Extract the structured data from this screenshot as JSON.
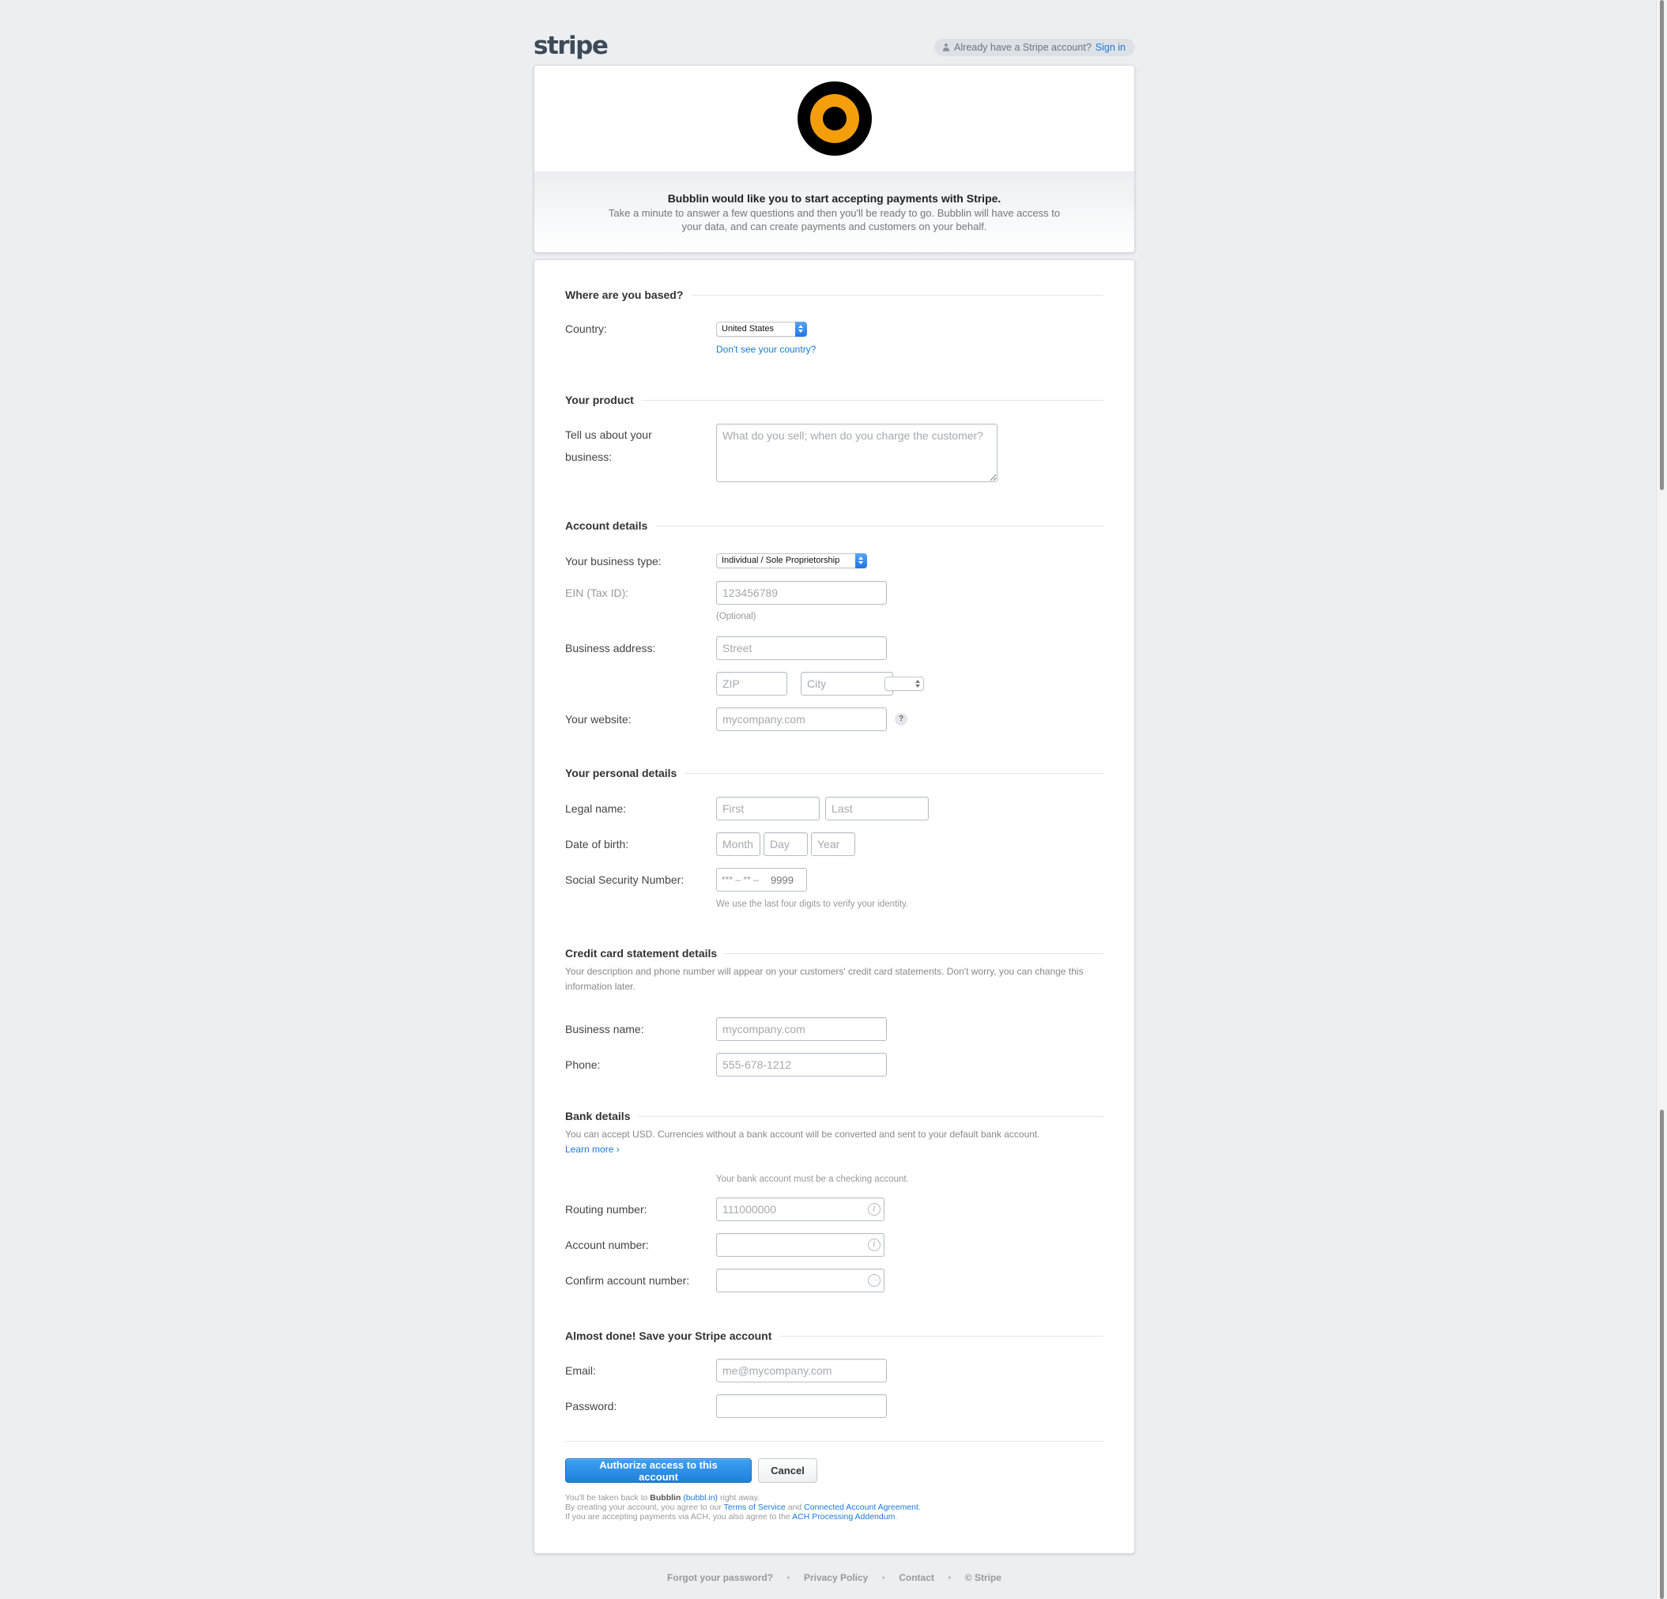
{
  "brand": {
    "logo_text": "stripe"
  },
  "signin": {
    "prompt": "Already have a Stripe account?",
    "link": "Sign in"
  },
  "header": {
    "title": "Bubblin would like you to start accepting payments with Stripe.",
    "description": "Take a minute to answer a few questions and then you'll be ready to go. Bubblin will have access to your data, and can create payments and customers on your behalf."
  },
  "location": {
    "title": "Where are you based?",
    "country_label": "Country:",
    "country_value": "United States",
    "missing_country_link": "Don't see your country?"
  },
  "product": {
    "title": "Your product",
    "business_label_line1": "Tell us about your",
    "business_label_line2": "business:",
    "business_placeholder": "What do you sell; when do you charge the customer?"
  },
  "account": {
    "title": "Account details",
    "business_type_label": "Your business type:",
    "business_type_value": "Individual / Sole Proprietorship",
    "ein_label": "EIN (Tax ID):",
    "ein_placeholder": "123456789",
    "ein_hint": "(Optional)",
    "address_label": "Business address:",
    "street_placeholder": "Street",
    "zip_placeholder": "ZIP",
    "city_placeholder": "City",
    "website_label": "Your website:",
    "website_placeholder": "mycompany.com",
    "website_help": "?"
  },
  "personal": {
    "title": "Your personal details",
    "legal_name_label": "Legal name:",
    "first_placeholder": "First",
    "last_placeholder": "Last",
    "dob_label": "Date of birth:",
    "month_placeholder": "Month",
    "day_placeholder": "Day",
    "year_placeholder": "Year",
    "ssn_label": "Social Security Number:",
    "ssn_mask": "*** – ** –",
    "ssn_placeholder": "9999",
    "ssn_hint": "We use the last four digits to verify your identity."
  },
  "statement": {
    "title": "Credit card statement details",
    "note": "Your description and phone number will appear on your customers' credit card statements. Don't worry, you can change this information later.",
    "business_name_label": "Business name:",
    "business_name_placeholder": "mycompany.com",
    "phone_label": "Phone:",
    "phone_placeholder": "555-678-1212"
  },
  "bank": {
    "title": "Bank details",
    "note": "You can accept USD. Currencies without a bank account will be converted and sent to your default bank account.",
    "learn_more": "Learn more ›",
    "checking_hint": "Your bank account must be a checking account.",
    "routing_label": "Routing number:",
    "routing_placeholder": "111000000",
    "account_label": "Account number:",
    "confirm_label": "Confirm account number:"
  },
  "save": {
    "title": "Almost done! Save your Stripe account",
    "email_label": "Email:",
    "email_placeholder": "me@mycompany.com",
    "password_label": "Password:"
  },
  "actions": {
    "authorize": "Authorize access to this account",
    "cancel": "Cancel"
  },
  "legal": {
    "line1_pre": "You'll be taken back to",
    "app_name": "Bubblin",
    "app_url": "(bubbl.in)",
    "line1_post": "right away.",
    "line2_pre": "By creating your account, you agree to our",
    "tos": "Terms of Service",
    "and": "and",
    "caa": "Connected Account Agreement",
    "line3_pre": "If you are accepting payments via ACH, you also agree to the",
    "ach": "ACH Processing Addendum"
  },
  "footer": {
    "forgot": "Forgot your password?",
    "privacy": "Privacy Policy",
    "contact": "Contact",
    "copyright": "© Stripe",
    "separator": "•"
  },
  "colors": {
    "accent": "#1b7ad8",
    "app_logo_orange": "#f59e0b",
    "background": "#eceef1"
  }
}
